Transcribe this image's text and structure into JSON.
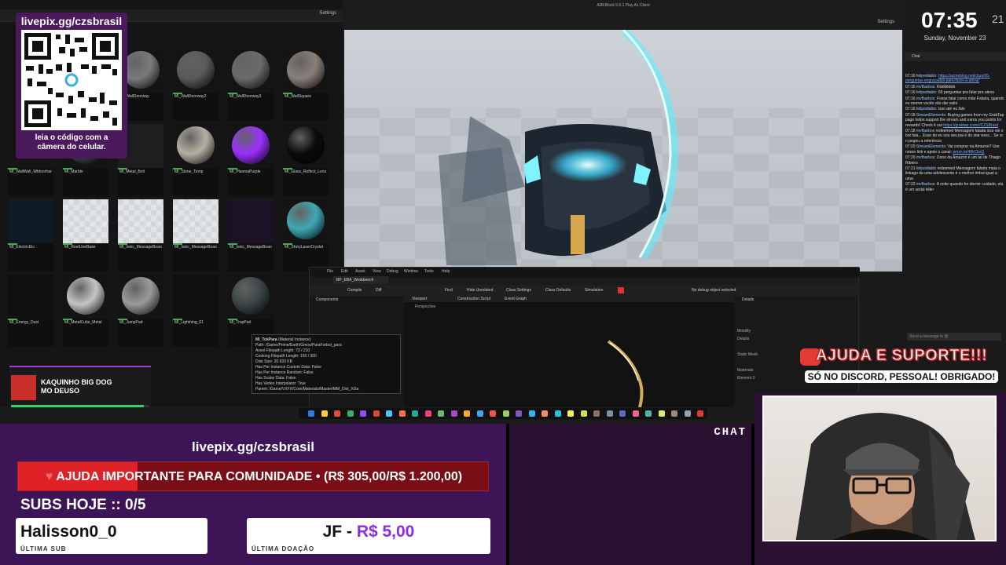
{
  "qr": {
    "title": "livepix.gg/czsbrasil",
    "caption_line1": "leia o código com a",
    "caption_line2": "câmera do celular."
  },
  "content_browser": {
    "settings_label": "Settings",
    "assets": [
      {
        "label": "MI_WallDoorway",
        "type": "sphere",
        "color": "#7a7a7a"
      },
      {
        "label": "MI_WallDoorway2",
        "type": "sphere",
        "color": "#5a5a5a"
      },
      {
        "label": "MI_WallDoorway3",
        "type": "sphere",
        "color": "#6a6a6a"
      },
      {
        "label": "MI_WallSquare",
        "type": "sphere",
        "color": "#8a7f78"
      },
      {
        "label": "MI_WallWall_Wtdoorframe",
        "type": "dark",
        "color": "#151515"
      },
      {
        "label": "MI_Metal_Bolt",
        "type": "dark",
        "color": "#1e1e1e"
      },
      {
        "label": "MI_Marble",
        "type": "sphere",
        "color": "#3a4a4a"
      },
      {
        "label": "MI_Stone_Temp",
        "type": "sphere",
        "color": "#b5b0a4"
      },
      {
        "label": "MI_PlasmaPurple",
        "type": "sphere",
        "color": "#9b30ff"
      },
      {
        "label": "MI_Glass_Reflect_Lens",
        "type": "sphere",
        "color": "#0b0b0b"
      },
      {
        "label": "MI_ElectricEtc",
        "type": "dark",
        "color": "#0e1a24"
      },
      {
        "label": "MI_ReelLineBase",
        "type": "checker",
        "color": "#d4d8dc"
      },
      {
        "label": "MI_Ionic_MessageBoard",
        "type": "checker",
        "color": "#d4d8dc"
      },
      {
        "label": "MI_Ionic_MessageBoard_Hero",
        "type": "checker",
        "color": "#d4d8dc"
      },
      {
        "label": "MI_Ionic_MessageBoard_Alt",
        "type": "dark",
        "color": "#1c1226"
      },
      {
        "label": "MI_ShinyLaserCrystal",
        "type": "sphere",
        "color": "#3fa7b5"
      },
      {
        "label": "MI_Energy_Dust",
        "type": "dark",
        "color": "#111"
      },
      {
        "label": "MI_MetalCube_Metal",
        "type": "sphere",
        "color": "#c4c4c4"
      },
      {
        "label": "MI_JumpPad",
        "type": "sphere",
        "color": "#9a9a9a"
      },
      {
        "label": "MI_Lightning_01",
        "type": "dark",
        "color": "#101010"
      },
      {
        "label": "MI_TrapPad",
        "type": "sphere",
        "color": "#3a4545"
      }
    ]
  },
  "tooltip": {
    "title": "MI_TokPara",
    "subtitle": "(Material Instance)",
    "lines": [
      "Path: /Game/Prime/Earth/Gmos/ParaForbot_para",
      "Asset Filepath Length: 73 / 210",
      "Cooking Filepath Length: 150 / 300",
      "Disk Size: 20.933 KB",
      "Has Per Instance Custom Data: False",
      "Has Per Instance Random: False",
      "Has Scalar Data: False",
      "Has Vertex Interpolator: True",
      "Parent: /Game/VXFX/Core/Materials/Master/MM_Dist_XGa"
    ]
  },
  "viewport": {
    "title": "ARKBlock 5.6.1 Play As Client",
    "settings_label": "Settings"
  },
  "blueprint": {
    "menu": [
      "File",
      "Edit",
      "Asset",
      "View",
      "Debug",
      "Window",
      "Tools",
      "Help"
    ],
    "tab": "BP_EBA_Workbench",
    "toolbar": [
      "Compile",
      "Diff",
      "Find",
      "Hide Unrelated",
      "Class Settings",
      "Class Defaults",
      "Simulation"
    ],
    "panels": {
      "components": "Components",
      "viewport": "Viewport",
      "construction": "Construction Script",
      "event_graph": "Event Graph",
      "details": "Details",
      "perspective": "Perspective"
    },
    "details_rows": [
      "Mobility",
      "Details",
      "Static Mesh",
      "Materials",
      "Element 0"
    ],
    "debug_filter": "No debug object selected"
  },
  "clock": {
    "time": "07:35",
    "seconds": "21",
    "date": "Sunday, November 23"
  },
  "chat": {
    "header": "Chat",
    "messages": [
      {
        "time": "07:16",
        "user": "felipediablo:",
        "text": "",
        "link": "https://acmeblog.net/cbus/65-perguntas-engracadas-para-fazer-a-alexa/"
      },
      {
        "time": "07:16",
        "user": "mvfbarbos:",
        "text": "Kkkkkkkkk",
        "link": ""
      },
      {
        "time": "07:16",
        "user": "felipediablo:",
        "text": "65 perguntas pra falar pra alexa",
        "link": ""
      },
      {
        "time": "07:16",
        "user": "mvfbarbos:",
        "text": "Fosse falar como mãe Falaria, quando eu morrer vocês vão dar valor",
        "link": ""
      },
      {
        "time": "07:16",
        "user": "felipediablo:",
        "text": "isso até eu falo",
        "link": ""
      },
      {
        "time": "07:18",
        "user": "StreamElements:",
        "text": "Buying games from my GrabTap page helps support the stream and earns you points for rewards! Check it out",
        "link": "https://grabtap.com/r/CZSBrasil"
      },
      {
        "time": "07:18",
        "user": "mvfbarbos",
        "text": "redeemed Mensagem falada isso sei o bot fala... Esse do eu sou seu pai é do star wars... Se vc n pegou a referência",
        "link": ""
      },
      {
        "time": "07:20",
        "user": "StreamElements:",
        "text": "Vai comprar na Amazon? Use nosso link e apoie o canal:",
        "link": "amzn.to/48kCbsQ"
      },
      {
        "time": "07:20",
        "user": "mvfbarbos:",
        "text": "Dono da Amazon é um tal de Thiago Ribeiro",
        "link": ""
      },
      {
        "time": "07:21",
        "user": "felipediablo",
        "text": "redeemed Mensagem falada mata o linkago da uma adolescente é o melhor imbui igual a uma",
        "link": ""
      },
      {
        "time": "07:22",
        "user": "mvfbarbos:",
        "text": "A noite quando for dormir cuidado, ela é um serial killer",
        "link": ""
      }
    ],
    "input_placeholder": "Send a message to @"
  },
  "help_badge": {
    "title": "AJUDA E SUPORTE!!!",
    "subtitle": "SÓ NO DISCORD, PESSOAL! OBRIGADO!"
  },
  "song": {
    "title": "KAQUINHO BIG DOG",
    "subtitle": "MO DEUSO",
    "progress": 0.96
  },
  "overlay": {
    "url": "livepix.gg/czsbrasil",
    "goal": {
      "label": "AJUDA IMPORTANTE PARA COMUNIDADE",
      "separator": "•",
      "amount": "(R$ 305,00/R$ 1.200,00)",
      "current": 305,
      "target": 1200
    },
    "subs_today": "SUBS HOJE :: 0/5",
    "last_sub": {
      "name": "Halisson0_0",
      "caption": "ÚLTIMA SUB"
    },
    "last_donation": {
      "name": "JF -",
      "amount": "R$ 5,00",
      "caption": "ÚLTIMA DOAÇÃO"
    },
    "chat_label": "CHAT"
  },
  "colors": {
    "accent_purple": "#8b2be2",
    "goal_red": "#e02127",
    "overlay_bg": "#3d1456",
    "lightning": "#5ef0ff"
  }
}
